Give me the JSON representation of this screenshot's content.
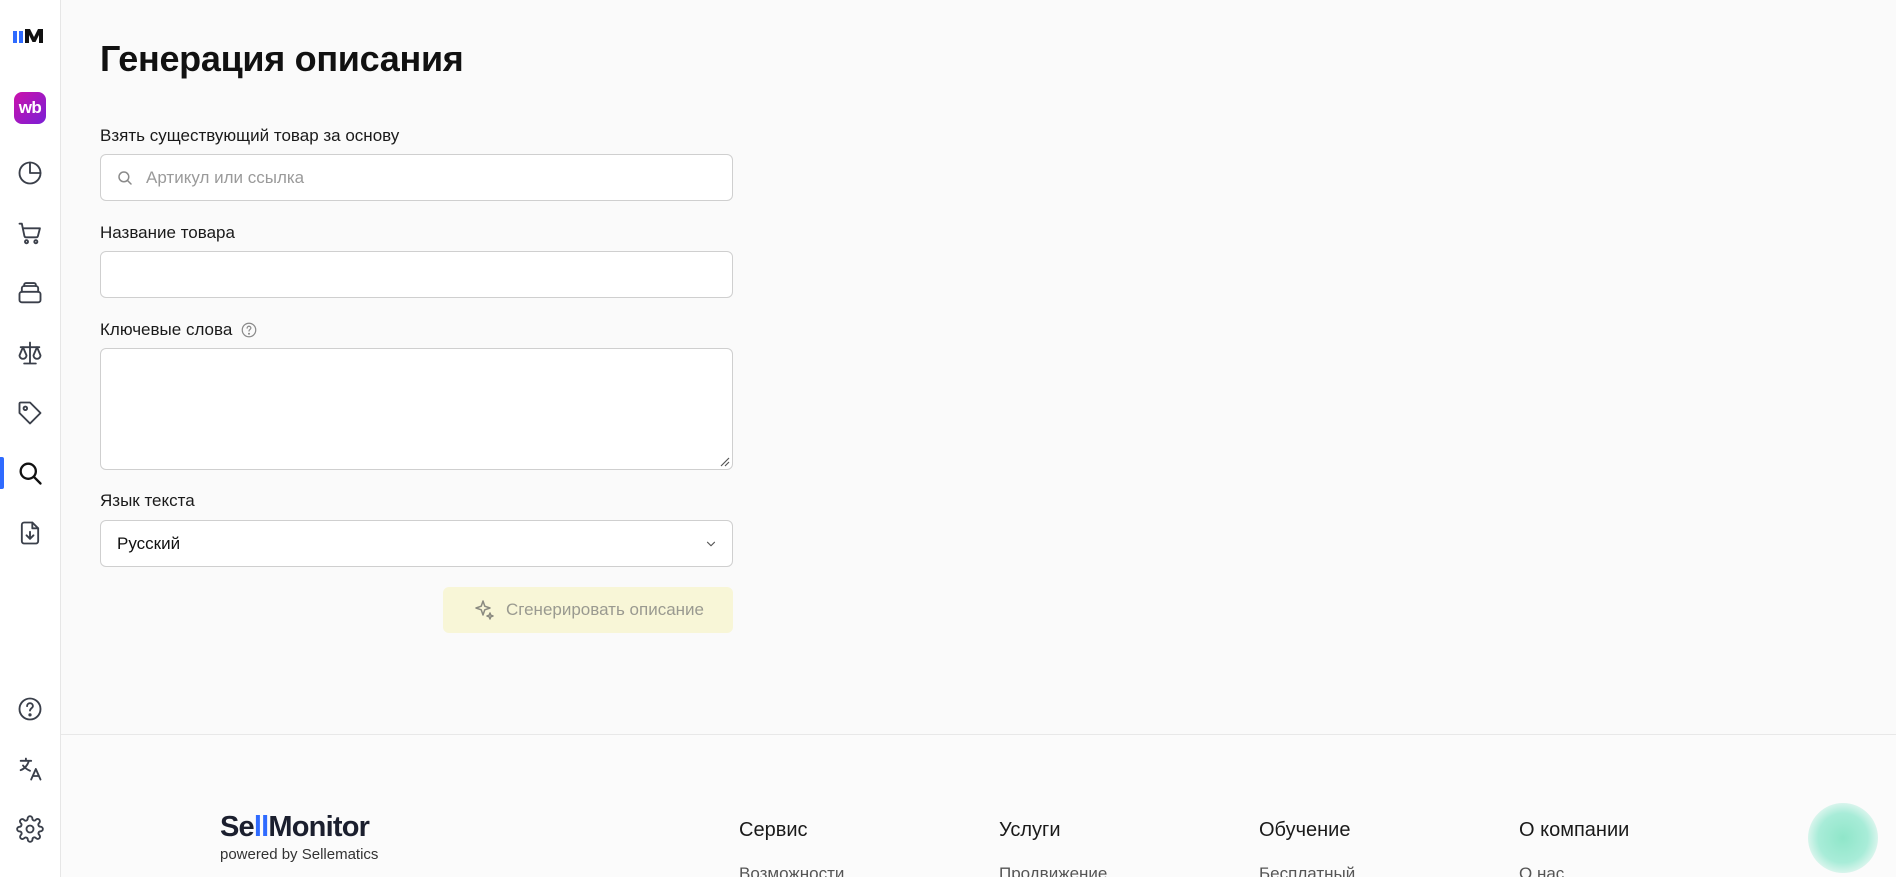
{
  "sidebar": {
    "logo_icon": "sellmonitor-logo-icon",
    "marketplace_badge": "wb",
    "items": [
      {
        "icon": "pie-chart-icon"
      },
      {
        "icon": "cart-icon"
      },
      {
        "icon": "inventory-icon"
      },
      {
        "icon": "scales-icon"
      },
      {
        "icon": "tag-icon"
      },
      {
        "icon": "search-icon",
        "active": true
      },
      {
        "icon": "file-download-icon"
      }
    ],
    "bottom_items": [
      {
        "icon": "help-circle-icon"
      },
      {
        "icon": "translate-icon"
      },
      {
        "icon": "gear-icon"
      }
    ],
    "accent_color": "#2f6bff"
  },
  "page": {
    "title": "Генерация описания"
  },
  "form": {
    "base_product": {
      "label": "Взять существующий товар за основу",
      "placeholder": "Артикул или ссылка",
      "value": ""
    },
    "product_name": {
      "label": "Название товара",
      "value": ""
    },
    "keywords": {
      "label": "Ключевые слова",
      "value": ""
    },
    "language": {
      "label": "Язык текста",
      "selected": "Русский"
    },
    "generate_button": "Сгенерировать описание"
  },
  "footer": {
    "logo": {
      "part1": "Se",
      "part2": "ll",
      "part3": "Monitor"
    },
    "powered_by": "powered by Sellematics",
    "columns": [
      {
        "heading": "Сервис",
        "first_link": "Возможности"
      },
      {
        "heading": "Услуги",
        "first_link": "Продвижение"
      },
      {
        "heading": "Обучение",
        "first_link": "Бесплатный"
      },
      {
        "heading": "О компании",
        "first_link": "О нас"
      }
    ]
  }
}
